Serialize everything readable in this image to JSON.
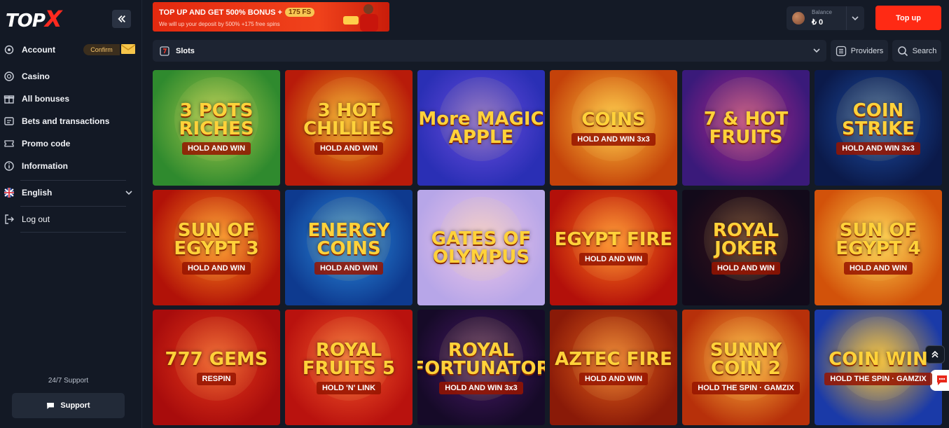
{
  "brand": {
    "logo_text": "TOP",
    "logo_mark": "X"
  },
  "sidebar": {
    "items": [
      {
        "label": "Account",
        "icon": "gear-icon"
      },
      {
        "label": "Casino",
        "icon": "casino-chip-icon"
      },
      {
        "label": "All bonuses",
        "icon": "gift-icon"
      },
      {
        "label": "Bets and transactions",
        "icon": "receipt-icon"
      },
      {
        "label": "Promo code",
        "icon": "ticket-icon"
      },
      {
        "label": "Information",
        "icon": "info-icon"
      }
    ],
    "confirm_label": "Confirm",
    "language": "English",
    "logout": "Log out",
    "support_title": "24/7 Support",
    "support_button": "Support"
  },
  "promo": {
    "title": "TOP UP AND GET 500% BONUS +",
    "fs_badge": "175 FS",
    "subtitle": "We will up your deposit by 500% +175 free spins"
  },
  "balance": {
    "label": "Balance",
    "value": "₺ 0"
  },
  "topup_label": "Top up",
  "filter": {
    "category": "Slots",
    "providers": "Providers",
    "search": "Search"
  },
  "games": [
    {
      "title": "3 POTS RICHES",
      "sub": "HOLD AND WIN",
      "bg1": "#2f8a2e",
      "bg2": "#a6c94a"
    },
    {
      "title": "3 HOT CHILLIES",
      "sub": "HOLD AND WIN",
      "bg1": "#b81b0a",
      "bg2": "#f0a21a"
    },
    {
      "title": "More MAGIC APPLE",
      "sub": "",
      "bg1": "#2a2fb5",
      "bg2": "#6c4ee0"
    },
    {
      "title": "COINS",
      "sub": "HOLD AND WIN 3x3",
      "bg1": "#c4420a",
      "bg2": "#ffc23a"
    },
    {
      "title": "7 & HOT FRUITS",
      "sub": "",
      "bg1": "#3a1a7a",
      "bg2": "#b0268a"
    },
    {
      "title": "COIN STRIKE",
      "sub": "HOLD AND WIN 3x3",
      "bg1": "#0b1a4a",
      "bg2": "#1d4fa8"
    },
    {
      "title": "SUN OF EGYPT 3",
      "sub": "HOLD AND WIN",
      "bg1": "#b11208",
      "bg2": "#ff8a1a"
    },
    {
      "title": "ENERGY COINS",
      "sub": "HOLD AND WIN",
      "bg1": "#0e3a8f",
      "bg2": "#2b8de0"
    },
    {
      "title": "GATES OF OLYMPUS",
      "sub": "",
      "bg1": "#b7a6e8",
      "bg2": "#f0c6e8"
    },
    {
      "title": "EGYPT FIRE",
      "sub": "HOLD AND WIN",
      "bg1": "#b3100a",
      "bg2": "#ff7a1a"
    },
    {
      "title": "ROYAL JOKER",
      "sub": "HOLD AND WIN",
      "bg1": "#120a1a",
      "bg2": "#3a0f1a"
    },
    {
      "title": "SUN OF EGYPT 4",
      "sub": "HOLD AND WIN",
      "bg1": "#d2520a",
      "bg2": "#ffd04a"
    },
    {
      "title": "777 GEMS",
      "sub": "RESPIN",
      "bg1": "#a80c0c",
      "bg2": "#e83a1a"
    },
    {
      "title": "ROYAL FRUITS 5",
      "sub": "HOLD 'N' LINK",
      "bg1": "#b9120e",
      "bg2": "#f4582a"
    },
    {
      "title": "ROYAL FORTUNATOR",
      "sub": "HOLD AND WIN 3x3",
      "bg1": "#160a28",
      "bg2": "#4a1a6a"
    },
    {
      "title": "AZTEC FIRE",
      "sub": "HOLD AND WIN",
      "bg1": "#8a1a08",
      "bg2": "#e5621a"
    },
    {
      "title": "SUNNY COIN 2",
      "sub": "HOLD THE SPIN · GAMZIX",
      "bg1": "#b7300a",
      "bg2": "#ffb43a"
    },
    {
      "title": "COIN WIN",
      "sub": "HOLD THE SPIN · GAMZIX",
      "bg1": "#1a3aa8",
      "bg2": "#f1b52a"
    }
  ],
  "colors": {
    "accent": "#ff2a14",
    "sidebar_bg": "#131925",
    "page_bg": "#141a26"
  }
}
